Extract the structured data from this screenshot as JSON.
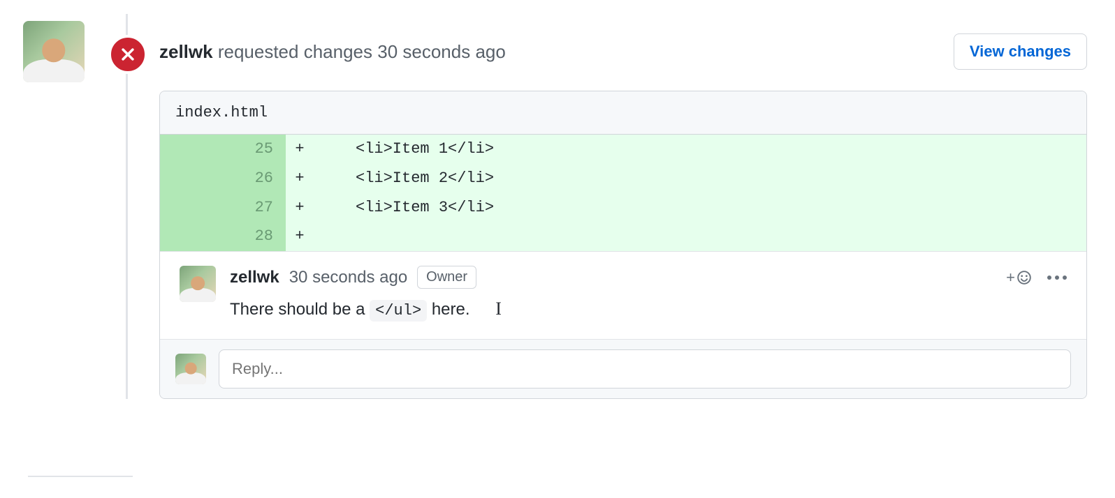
{
  "review": {
    "author": "zellwk",
    "action_text": "requested changes",
    "time": "30 seconds ago",
    "view_changes_label": "View changes"
  },
  "file": {
    "name": "index.html"
  },
  "diff": [
    {
      "ln": "25",
      "marker": "+",
      "code": "<li>Item 1</li>"
    },
    {
      "ln": "26",
      "marker": "+",
      "code": "<li>Item 2</li>"
    },
    {
      "ln": "27",
      "marker": "+",
      "code": "<li>Item 3</li>"
    },
    {
      "ln": "28",
      "marker": "+",
      "code": ""
    }
  ],
  "comment": {
    "author": "zellwk",
    "time": "30 seconds ago",
    "badge": "Owner",
    "text_before": "There should be a ",
    "code": "</ul>",
    "text_after": " here."
  },
  "reply": {
    "placeholder": "Reply..."
  }
}
